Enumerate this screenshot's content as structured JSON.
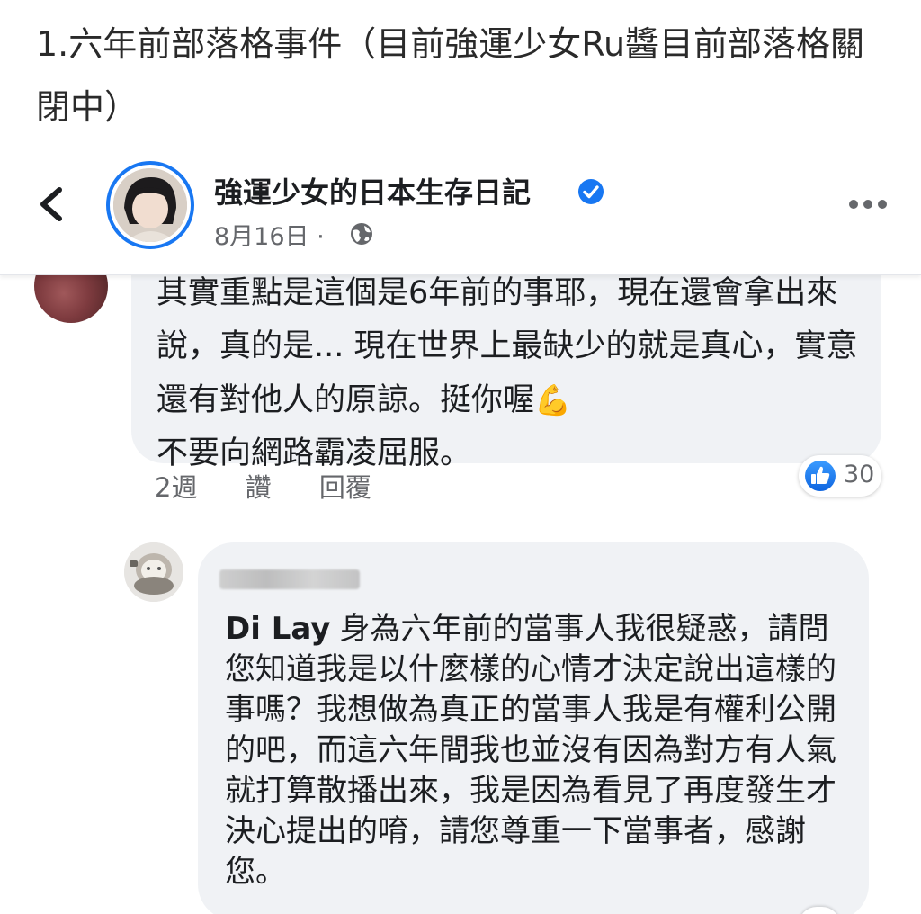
{
  "caption": {
    "text": "1.六年前部落格事件（目前強運少女Ru醬目前部落格關閉中）"
  },
  "post_header": {
    "page_name": "強運少女的日本生存日記",
    "date": "8月16日 ·",
    "verified_icon": "verified-badge-icon",
    "globe_icon": "globe-icon",
    "back_icon": "chevron-left-icon",
    "more_icon": "more-horizontal-icon"
  },
  "comment_1": {
    "text": "其實重點是這個是6年前的事耶，現在還會拿出來說，真的是... 現在世界上最缺少的就是真心，實意還有對他人的原諒。挺你喔",
    "emoji": "💪",
    "text_tail": "不要向網路霸凌屈服。",
    "time": "2週",
    "like_label": "讚",
    "reply_label": "回覆",
    "reaction_count": "30",
    "reaction_icon": "like-thumb-icon"
  },
  "comment_2": {
    "mention": "Di Lay",
    "text": "身為六年前的當事人我很疑惑，請問您知道我是以什麼樣的心情才決定說出這樣的事嗎？我想做為真正的當事人我是有權利公開的吧，而這六年間我也並沒有因為對方有人氣就打算散播出來，我是因為看見了再度發生才決心提出的唷，請您尊重一下當事者，感謝您。"
  },
  "colors": {
    "accent": "#1877f2",
    "bubble": "#f0f2f5",
    "secondary_text": "#65676b"
  }
}
